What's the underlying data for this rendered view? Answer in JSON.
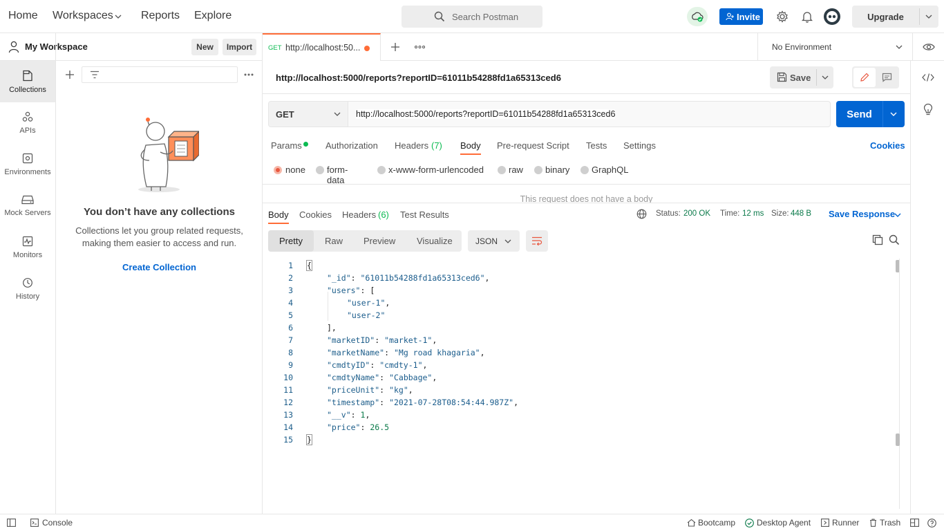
{
  "topbar": {
    "nav": [
      "Home",
      "Workspaces",
      "Reports",
      "Explore"
    ],
    "search_placeholder": "Search Postman",
    "invite_label": "Invite",
    "upgrade_label": "Upgrade"
  },
  "workspace": {
    "name": "My Workspace",
    "new_label": "New",
    "import_label": "Import"
  },
  "rail": [
    "Collections",
    "APIs",
    "Environments",
    "Mock Servers",
    "Monitors",
    "History"
  ],
  "sidebar": {
    "empty_title": "You don’t have any collections",
    "empty_text_1": "Collections let you group related requests,",
    "empty_text_2": "making them easier to access and run.",
    "create_label": "Create Collection"
  },
  "tab": {
    "method": "GET",
    "title": "http://localhost:50...",
    "environment": "No Environment"
  },
  "request": {
    "name": "http://localhost:5000/reports?reportID=61011b54288fd1a65313ced6",
    "save_label": "Save",
    "method": "GET",
    "url": "http://localhost:5000/reports?reportID=61011b54288fd1a65313ced6",
    "send_label": "Send",
    "tabs": [
      "Params",
      "Authorization",
      "Headers",
      "Body",
      "Pre-request Script",
      "Tests",
      "Settings"
    ],
    "headers_count": "(7)",
    "cookies_label": "Cookies",
    "body_types": [
      "none",
      "form-data",
      "x-www-form-urlencoded",
      "raw",
      "binary",
      "GraphQL"
    ],
    "no_body_text": "This request does not have a body"
  },
  "response": {
    "tabs": [
      "Body",
      "Cookies",
      "Headers",
      "Test Results"
    ],
    "headers_count": "(6)",
    "status_label": "Status:",
    "status_value": "200 OK",
    "time_label": "Time:",
    "time_value": "12 ms",
    "size_label": "Size:",
    "size_value": "448 B",
    "save_response_label": "Save Response",
    "views": [
      "Pretty",
      "Raw",
      "Preview",
      "Visualize"
    ],
    "format": "JSON",
    "lines": [
      "{",
      "\"_id\": \"61011b54288fd1a65313ced6\",",
      "\"users\": [",
      "\"user-1\",",
      "\"user-2\"",
      "],",
      "\"marketID\": \"market-1\",",
      "\"marketName\": \"Mg road khagaria\",",
      "\"cmdtyID\": \"cmdty-1\",",
      "\"cmdtyName\": \"Cabbage\",",
      "\"priceUnit\": \"kg\",",
      "\"timestamp\": \"2021-07-28T08:54:44.987Z\",",
      "\"__v\": 1,",
      "\"price\": 26.5",
      "}"
    ]
  },
  "statusbar": {
    "console_label": "Console",
    "bootcamp_label": "Bootcamp",
    "agent_label": "Desktop Agent",
    "runner_label": "Runner",
    "trash_label": "Trash"
  },
  "colors": {
    "accent": "#0265d2",
    "orange": "#ff6c37",
    "status_green": "#0b7a4a"
  }
}
